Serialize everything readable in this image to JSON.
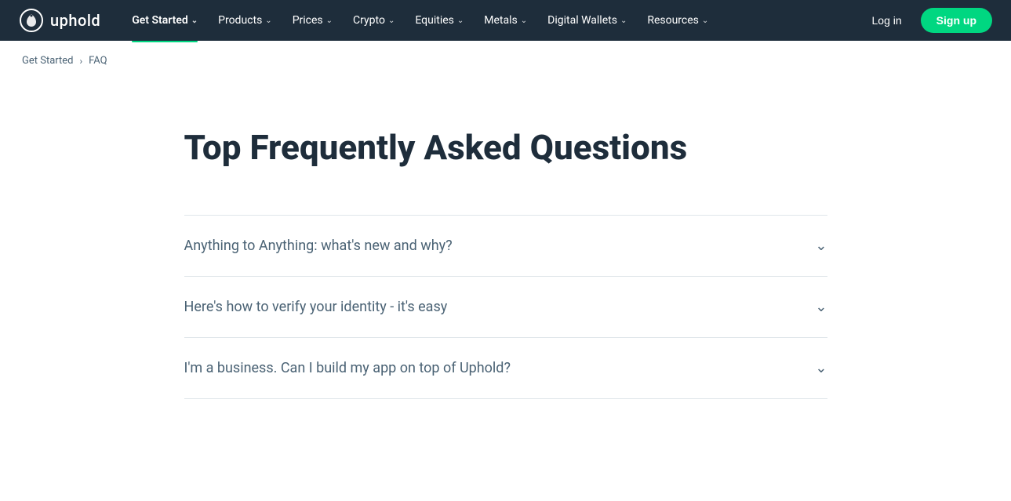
{
  "brand": {
    "logo_text": "uphold",
    "logo_aria": "Uphold home"
  },
  "navbar": {
    "items": [
      {
        "label": "Get Started",
        "active": true,
        "id": "get-started"
      },
      {
        "label": "Products",
        "active": false,
        "id": "products"
      },
      {
        "label": "Prices",
        "active": false,
        "id": "prices"
      },
      {
        "label": "Crypto",
        "active": false,
        "id": "crypto"
      },
      {
        "label": "Equities",
        "active": false,
        "id": "equities"
      },
      {
        "label": "Metals",
        "active": false,
        "id": "metals"
      },
      {
        "label": "Digital Wallets",
        "active": false,
        "id": "digital-wallets"
      },
      {
        "label": "Resources",
        "active": false,
        "id": "resources"
      }
    ],
    "login_label": "Log in",
    "signup_label": "Sign up"
  },
  "breadcrumb": {
    "items": [
      {
        "label": "Get Started",
        "href": "#"
      },
      {
        "label": "FAQ",
        "current": true
      }
    ],
    "separator": "›"
  },
  "main": {
    "title": "Top Frequently Asked Questions",
    "faq_items": [
      {
        "question": "Anything to Anything: what's new and why?"
      },
      {
        "question": "Here's how to verify your identity - it's easy"
      },
      {
        "question": "I'm a business. Can I build my app on top of Uphold?"
      }
    ]
  }
}
